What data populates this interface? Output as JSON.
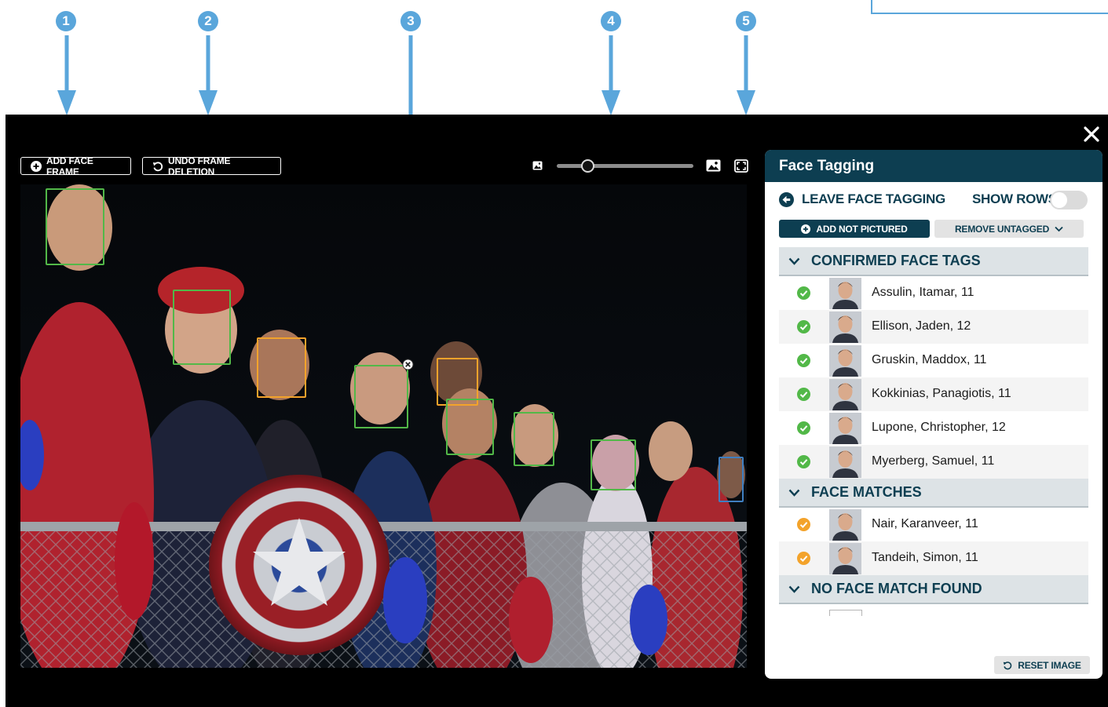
{
  "callouts": [
    "1",
    "2",
    "3",
    "4",
    "5"
  ],
  "toolbar": {
    "add_face_frame": "ADD FACE FRAME",
    "undo_frame_deletion": "UNDO FRAME DELETION"
  },
  "zoom": {
    "level": 0.23
  },
  "panel": {
    "title": "Face Tagging",
    "leave_label": "LEAVE FACE TAGGING",
    "show_rows_label": "SHOW ROWS",
    "show_rows_enabled": false,
    "add_not_pictured": "ADD NOT PICTURED",
    "remove_untagged": "REMOVE UNTAGGED",
    "reset_image": "RESET IMAGE",
    "sections": {
      "confirmed": {
        "title": "CONFIRMED FACE TAGS",
        "people": [
          "Assulin, Itamar, 11",
          "Ellison, Jaden, 12",
          "Gruskin, Maddox, 11",
          "Kokkinias, Panagiotis, 11",
          "Lupone, Christopher, 12",
          "Myerberg, Samuel, 11"
        ]
      },
      "matches": {
        "title": "FACE MATCHES",
        "people": [
          "Nair, Karanveer, 11",
          "Tandeih, Simon, 11"
        ]
      },
      "no_match": {
        "title": "NO FACE MATCH FOUND"
      }
    }
  },
  "colors": {
    "callout": "#5aa6db",
    "header": "#0d3e51",
    "confirmed_frame": "#52b848",
    "match_frame": "#f3a32b",
    "unmatched_frame": "#3f7fc1"
  }
}
